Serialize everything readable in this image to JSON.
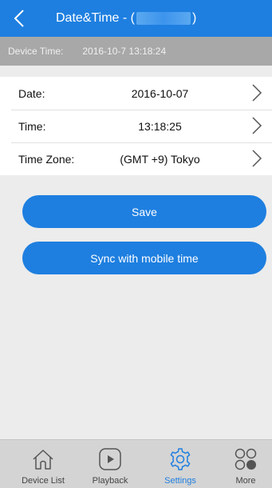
{
  "header": {
    "title_prefix": "Date&Time  - (",
    "title_suffix": ")"
  },
  "device_time": {
    "label": "Device Time:",
    "value": "2016-10-7 13:18:24"
  },
  "rows": [
    {
      "label": "Date:",
      "value": "2016-10-07"
    },
    {
      "label": "Time:",
      "value": "13:18:25"
    },
    {
      "label": "Time Zone:",
      "value": "(GMT +9) Tokyo"
    }
  ],
  "buttons": {
    "save": "Save",
    "sync": "Sync with mobile time"
  },
  "tabbar": {
    "device_list": "Device List",
    "playback": "Playback",
    "settings": "Settings",
    "more": "More",
    "active": "settings"
  },
  "colors": {
    "accent": "#1e7fe0",
    "device_bar": "#a8a8a8",
    "background": "#ececec",
    "tabbar": "#d4d4d4"
  },
  "icons": {
    "back": "chevron-left-icon",
    "row_chevron": "chevron-right-icon",
    "device_list": "home-icon",
    "playback": "play-icon",
    "settings": "gear-icon",
    "more": "more-circles-icon"
  }
}
